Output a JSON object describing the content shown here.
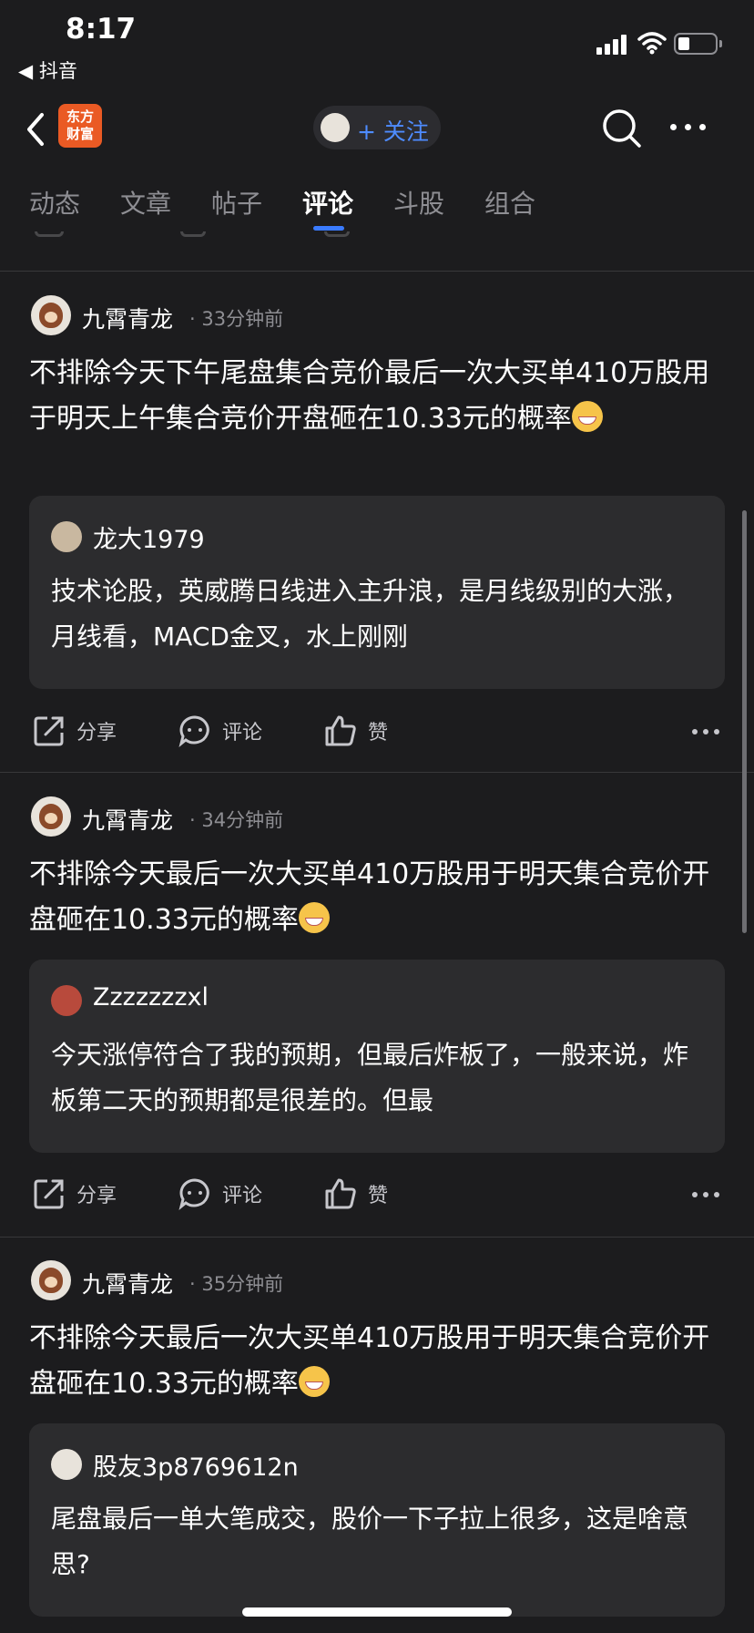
{
  "status_bar": {
    "time": "8:17",
    "back_app": "◀ 抖音"
  },
  "nav": {
    "logo_line1": "东方",
    "logo_line2": "财富",
    "follow_label": "+ 关注"
  },
  "tabs": [
    "动态",
    "文章",
    "帖子",
    "评论",
    "斗股",
    "组合"
  ],
  "active_tab": "评论",
  "posts": [
    {
      "user": "九霄青龙",
      "time": "· 33分钟前",
      "text": "不排除今天下午尾盘集合竞价最后一次大买单410万股用于明天上午集合竞价开盘砸在10.33元的概率",
      "quote_user": "龙大1979",
      "quote_text": "技术论股，英威腾日线进入主升浪，是月线级别的大涨，月线看，MACD金叉，水上刚刚"
    },
    {
      "user": "九霄青龙",
      "time": "· 34分钟前",
      "text": "不排除今天最后一次大买单410万股用于明天集合竞价开盘砸在10.33元的概率",
      "quote_user": "Zzzzzzzxl",
      "quote_text": "今天涨停符合了我的预期，但最后炸板了，一般来说，炸板第二天的预期都是很差的。但最"
    },
    {
      "user": "九霄青龙",
      "time": "· 35分钟前",
      "text": "不排除今天最后一次大买单410万股用于明天集合竞价开盘砸在10.33元的概率",
      "quote_user": "股友3p8769612n",
      "quote_text": "尾盘最后一单大笔成交，股价一下子拉上很多，这是啥意思?"
    }
  ],
  "actions": {
    "share": "分享",
    "comment": "评论",
    "like": "赞"
  },
  "colors": {
    "background": "#1c1c1e",
    "card": "#2c2c2e",
    "accent": "#3a7bff",
    "logo": "#ea5a24"
  }
}
